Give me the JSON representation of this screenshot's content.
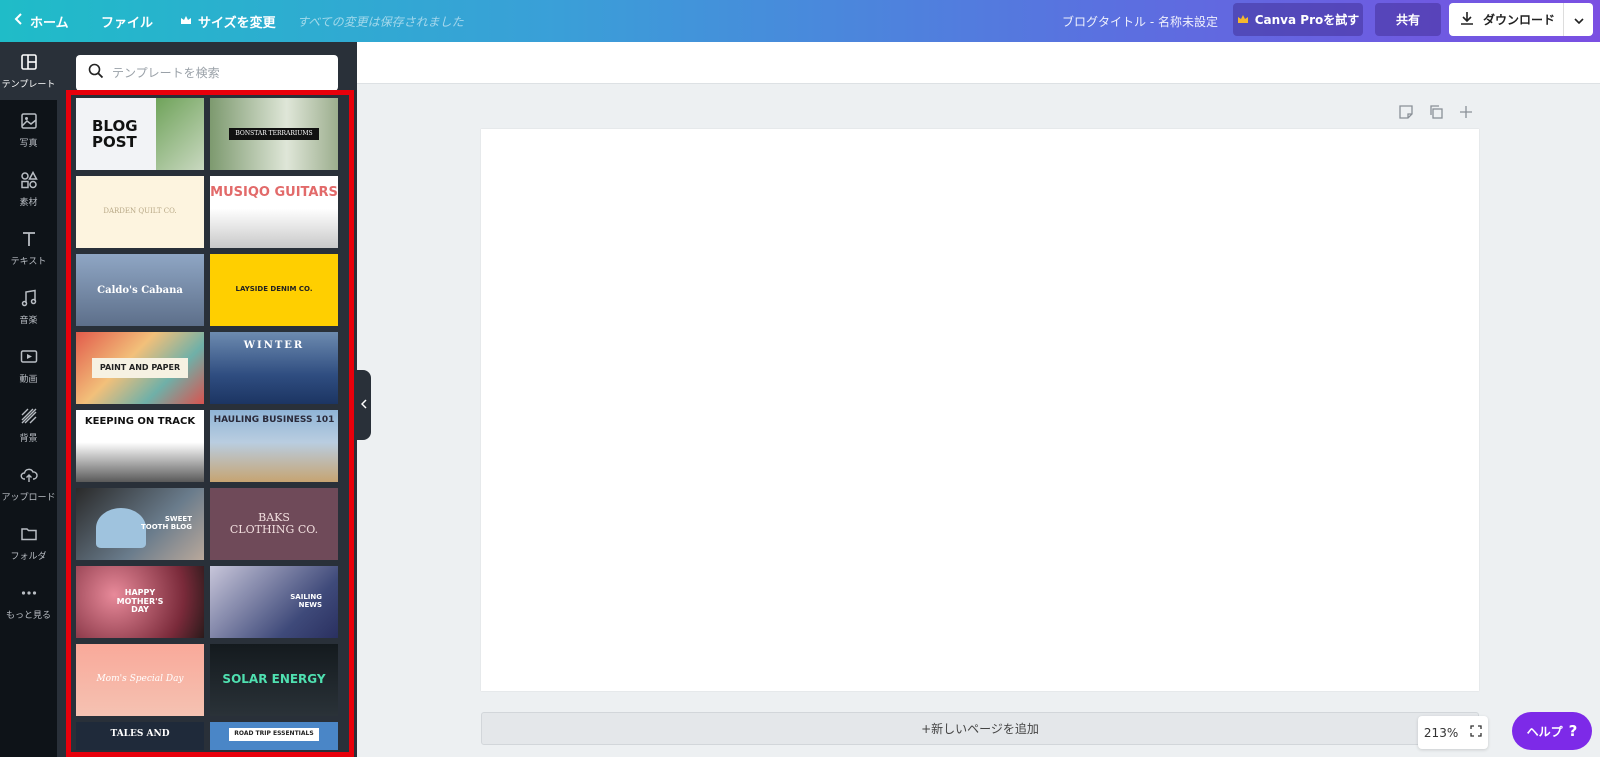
{
  "topbar": {
    "home_label": "ホーム",
    "file_label": "ファイル",
    "resize_label": "サイズを変更",
    "saved_status": "すべての変更は保存されました",
    "doc_title": "ブログタイトル - 名称未設定",
    "pro_label": "Canva Proを試す",
    "share_label": "共有",
    "download_label": "ダウンロード"
  },
  "rail": {
    "items": [
      {
        "label": "テンプレート",
        "icon": "template-icon"
      },
      {
        "label": "写真",
        "icon": "photo-icon"
      },
      {
        "label": "素材",
        "icon": "elements-icon"
      },
      {
        "label": "テキスト",
        "icon": "text-icon"
      },
      {
        "label": "音楽",
        "icon": "music-icon"
      },
      {
        "label": "動画",
        "icon": "video-icon"
      },
      {
        "label": "背景",
        "icon": "background-icon"
      },
      {
        "label": "アップロード",
        "icon": "upload-icon"
      },
      {
        "label": "フォルダ",
        "icon": "folder-icon"
      },
      {
        "label": "もっと見る",
        "icon": "more-icon"
      }
    ]
  },
  "search": {
    "placeholder": "テンプレートを検索"
  },
  "templates": [
    {
      "lines": [
        "BLOG",
        "POST"
      ]
    },
    {
      "lines": [
        "BONSTAR TERRARIUMS"
      ]
    },
    {
      "lines": [
        "DARDEN QUILT CO."
      ]
    },
    {
      "lines": [
        "MUSIQO GUITARS"
      ]
    },
    {
      "lines": [
        "Caldo's Cabana"
      ]
    },
    {
      "lines": [
        "LAYSIDE DENIM CO."
      ]
    },
    {
      "lines": [
        "PAINT AND PAPER"
      ]
    },
    {
      "lines": [
        "WINTER"
      ]
    },
    {
      "lines": [
        "KEEPING ON TRACK"
      ]
    },
    {
      "lines": [
        "HAULING BUSINESS 101"
      ]
    },
    {
      "lines": [
        "SWEET",
        "TOOTH BLOG"
      ]
    },
    {
      "lines": [
        "BAKS",
        "CLOTHING CO."
      ]
    },
    {
      "lines": [
        "HAPPY",
        "MOTHER'S",
        "DAY"
      ]
    },
    {
      "lines": [
        "SAILING",
        "NEWS"
      ]
    },
    {
      "lines": [
        "Mom's Special Day"
      ]
    },
    {
      "lines": [
        "SOLAR ENERGY"
      ]
    },
    {
      "lines": [
        "TALES AND"
      ]
    },
    {
      "lines": [
        "ROAD TRIP ESSENTIALS"
      ]
    }
  ],
  "canvas": {
    "add_page_label": "+新しいページを追加",
    "zoom": "213%",
    "help_label": "ヘルプ",
    "help_mark": "?"
  },
  "colors": {
    "help": "#7d2ae8",
    "highlight": "#e8000b",
    "panel": "#293039",
    "rail": "#0e1318"
  }
}
